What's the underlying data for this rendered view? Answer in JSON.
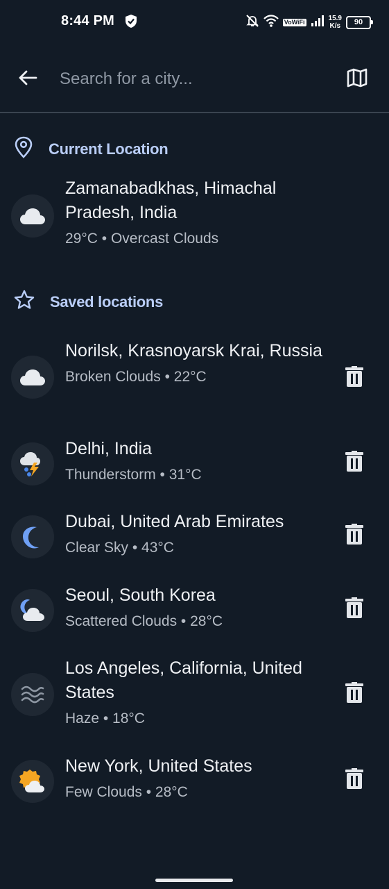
{
  "status_bar": {
    "time": "8:44 PM",
    "network_speed_value": "15.9",
    "network_speed_unit": "K/s",
    "volte": "VoWiFi",
    "battery": "90"
  },
  "search": {
    "placeholder": "Search for a city...",
    "back_icon": "arrow-left-icon",
    "map_icon": "map-icon"
  },
  "current_location": {
    "header": "Current Location",
    "header_icon": "location-pin-icon",
    "name": "Zamanabadkhas, Himachal Pradesh, India",
    "detail": "29°C • Overcast Clouds",
    "weather_icon": "cloud-icon"
  },
  "saved_locations": {
    "header": "Saved locations",
    "header_icon": "star-icon",
    "items": [
      {
        "name": "Norilsk, Krasnoyarsk Krai, Russia",
        "detail": "Broken Clouds • 22°C",
        "weather_icon": "cloud-icon"
      },
      {
        "name": "Delhi, India",
        "detail": "Thunderstorm • 31°C",
        "weather_icon": "thunderstorm-icon"
      },
      {
        "name": "Dubai, United Arab Emirates",
        "detail": "Clear Sky • 43°C",
        "weather_icon": "moon-icon"
      },
      {
        "name": "Seoul, South Korea",
        "detail": "Scattered Clouds • 28°C",
        "weather_icon": "moon-cloud-icon"
      },
      {
        "name": "Los Angeles, California, United States",
        "detail": "Haze • 18°C",
        "weather_icon": "haze-icon"
      },
      {
        "name": "New York, United States",
        "detail": "Few Clouds • 28°C",
        "weather_icon": "sun-cloud-icon"
      }
    ]
  },
  "colors": {
    "background": "#121b26",
    "accent": "#b9cdf6",
    "icon_circle": "#1f2833"
  }
}
